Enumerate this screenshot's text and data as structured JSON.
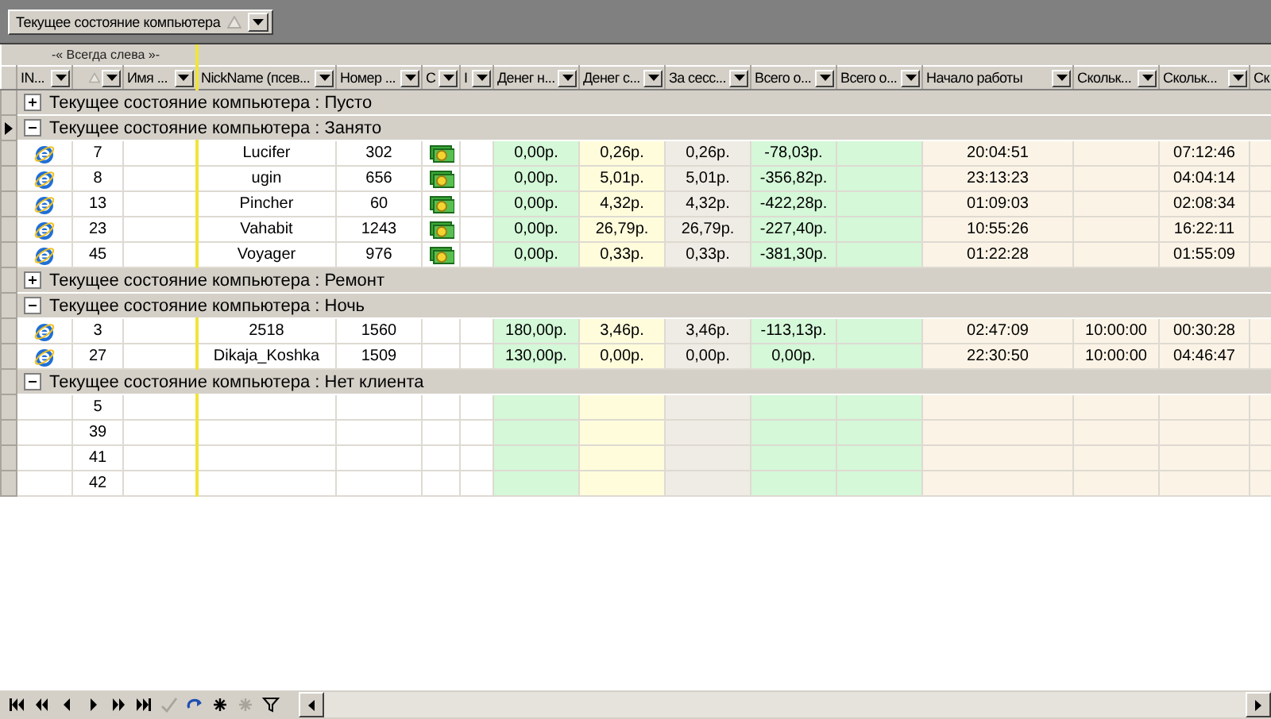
{
  "group_panel": {
    "label": "Текущее состояние компьютера",
    "sort_ascending": true
  },
  "fixed_band": {
    "label": "-« Всегда слева »-"
  },
  "columns": [
    {
      "label": "IN..."
    },
    {
      "sorted": true
    },
    {
      "label": "Имя ..."
    },
    {
      "label": "NickName (псев..."
    },
    {
      "label": "Номер ..."
    },
    {
      "label": "С"
    },
    {
      "label": "I"
    },
    {
      "label": "Денег н...",
      "color": "#d4f8d8"
    },
    {
      "label": "Денег с...",
      "color": "#fffcdc"
    },
    {
      "label": "За сесс...",
      "color": "#efece5"
    },
    {
      "label": "Всего о...",
      "color": "#d4f8d8"
    },
    {
      "label": "Всего о...",
      "color": "#d4f8d8"
    },
    {
      "label": "Начало работы",
      "color": "#fbf3e6"
    },
    {
      "label": "Скольк...",
      "color": "#fbf3e6"
    },
    {
      "label": "Скольк...",
      "color": "#fbf3e6"
    },
    {
      "label": "Ск",
      "color": "#fbf3e6"
    }
  ],
  "groups": [
    {
      "label": "Текущее состояние компьютера : Пусто",
      "expanded": false,
      "current": false
    },
    {
      "label": "Текущее состояние компьютера : Занято",
      "expanded": true,
      "current": true,
      "rows": [
        {
          "browser_icon": true,
          "money_icon": true,
          "cells": [
            null,
            "7",
            null,
            "Lucifer",
            "302",
            null,
            null,
            "0,00р.",
            "0,26р.",
            "0,26р.",
            "-78,03р.",
            null,
            "20:04:51",
            null,
            "07:12:46",
            null
          ]
        },
        {
          "browser_icon": true,
          "money_icon": true,
          "cells": [
            null,
            "8",
            null,
            "ugin",
            "656",
            null,
            null,
            "0,00р.",
            "5,01р.",
            "5,01р.",
            "-356,82р.",
            null,
            "23:13:23",
            null,
            "04:04:14",
            null
          ]
        },
        {
          "browser_icon": true,
          "money_icon": true,
          "cells": [
            null,
            "13",
            null,
            "Pincher",
            "60",
            null,
            null,
            "0,00р.",
            "4,32р.",
            "4,32р.",
            "-422,28р.",
            null,
            "01:09:03",
            null,
            "02:08:34",
            null
          ]
        },
        {
          "browser_icon": true,
          "money_icon": true,
          "cells": [
            null,
            "23",
            null,
            "Vahabit",
            "1243",
            null,
            null,
            "0,00р.",
            "26,79р.",
            "26,79р.",
            "-227,40р.",
            null,
            "10:55:26",
            null,
            "16:22:11",
            null
          ]
        },
        {
          "browser_icon": true,
          "money_icon": true,
          "cells": [
            null,
            "45",
            null,
            "Voyager",
            "976",
            null,
            null,
            "0,00р.",
            "0,33р.",
            "0,33р.",
            "-381,30р.",
            null,
            "01:22:28",
            null,
            "01:55:09",
            null
          ]
        }
      ]
    },
    {
      "label": "Текущее состояние компьютера : Ремонт",
      "expanded": false,
      "current": false
    },
    {
      "label": "Текущее состояние компьютера : Ночь",
      "expanded": true,
      "current": false,
      "rows": [
        {
          "browser_icon": true,
          "money_icon": false,
          "cells": [
            null,
            "3",
            null,
            "2518",
            "1560",
            null,
            null,
            "180,00р.",
            "3,46р.",
            "3,46р.",
            "-113,13р.",
            null,
            "02:47:09",
            "10:00:00",
            "00:30:28",
            null
          ]
        },
        {
          "browser_icon": true,
          "money_icon": false,
          "cells": [
            null,
            "27",
            null,
            "Dikaja_Koshka",
            "1509",
            null,
            null,
            "130,00р.",
            "0,00р.",
            "0,00р.",
            "0,00р.",
            null,
            "22:30:50",
            "10:00:00",
            "04:46:47",
            null
          ]
        }
      ]
    },
    {
      "label": "Текущее состояние компьютера : Нет клиента",
      "expanded": true,
      "current": false,
      "rows": [
        {
          "browser_icon": false,
          "money_icon": false,
          "cells": [
            null,
            "5",
            null,
            null,
            null,
            null,
            null,
            null,
            null,
            null,
            null,
            null,
            null,
            null,
            null,
            null
          ]
        },
        {
          "browser_icon": false,
          "money_icon": false,
          "cells": [
            null,
            "39",
            null,
            null,
            null,
            null,
            null,
            null,
            null,
            null,
            null,
            null,
            null,
            null,
            null,
            null
          ]
        },
        {
          "browser_icon": false,
          "money_icon": false,
          "cells": [
            null,
            "41",
            null,
            null,
            null,
            null,
            null,
            null,
            null,
            null,
            null,
            null,
            null,
            null,
            null,
            null
          ]
        },
        {
          "browser_icon": false,
          "money_icon": false,
          "cells": [
            null,
            "42",
            null,
            null,
            null,
            null,
            null,
            null,
            null,
            null,
            null,
            null,
            null,
            null,
            null,
            null
          ]
        }
      ]
    }
  ],
  "navigator": [
    {
      "kind": "first",
      "disabled": false
    },
    {
      "kind": "prior_page",
      "disabled": false
    },
    {
      "kind": "prior",
      "disabled": false
    },
    {
      "kind": "next",
      "disabled": false
    },
    {
      "kind": "next_page",
      "disabled": false
    },
    {
      "kind": "last",
      "disabled": false
    },
    {
      "kind": "post",
      "disabled": true
    },
    {
      "kind": "refresh",
      "disabled": false
    },
    {
      "kind": "insert",
      "disabled": false
    },
    {
      "kind": "insert",
      "disabled": true
    },
    {
      "kind": "filter",
      "disabled": false
    }
  ]
}
